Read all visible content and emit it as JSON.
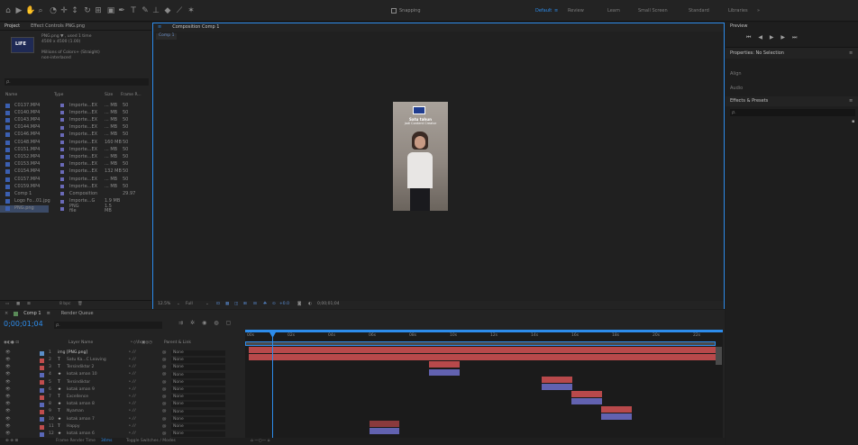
{
  "workspace": {
    "default": "Default",
    "review": "Review",
    "learn": "Learn",
    "small_screen": "Small Screen",
    "standard": "Standard",
    "libraries": "Libraries"
  },
  "toolbar": {
    "snapping": "Snapping"
  },
  "project": {
    "tab_project": "Project",
    "tab_effect_controls": "Effect Controls PNG.png",
    "preview_name": "PNG.png ▼ , used 1 time",
    "preview_size": "4500 x 4500 (1.00)",
    "preview_color": "Millions of Colors+ (Straight)",
    "preview_interlace": "non-interlaced",
    "thumb_text": "LIFE",
    "search_placeholder": "ρ.",
    "col_name": "Name",
    "col_type": "Type",
    "col_size": "Size",
    "col_frame": "Frame R...",
    "files": [
      {
        "name": "C0137.MP4",
        "type": "Importe...EX",
        "size": "... MB",
        "fr": "50"
      },
      {
        "name": "C0140.MP4",
        "type": "Importe...EX",
        "size": "... MB",
        "fr": "50"
      },
      {
        "name": "C0143.MP4",
        "type": "Importe...EX",
        "size": "... MB",
        "fr": "50"
      },
      {
        "name": "C0144.MP4",
        "type": "Importe...EX",
        "size": "... MB",
        "fr": "50"
      },
      {
        "name": "C0146.MP4",
        "type": "Importe...EX",
        "size": "... MB",
        "fr": "50"
      },
      {
        "name": "C0148.MP4",
        "type": "Importe...EX",
        "size": "160 MB",
        "fr": "50"
      },
      {
        "name": "C0151.MP4",
        "type": "Importe...EX",
        "size": "... MB",
        "fr": "50"
      },
      {
        "name": "C0152.MP4",
        "type": "Importe...EX",
        "size": "... MB",
        "fr": "50"
      },
      {
        "name": "C0153.MP4",
        "type": "Importe...EX",
        "size": "... MB",
        "fr": "50"
      },
      {
        "name": "C0154.MP4",
        "type": "Importe...EX",
        "size": "132 MB",
        "fr": "50"
      },
      {
        "name": "C0157.MP4",
        "type": "Importe...EX",
        "size": "... MB",
        "fr": "50"
      },
      {
        "name": "C0159.MP4",
        "type": "Importe...EX",
        "size": "... MB",
        "fr": "50"
      },
      {
        "name": "Comp 1",
        "type": "Composition",
        "size": "",
        "fr": "29.97"
      },
      {
        "name": "Logo Fo...01.jpg",
        "type": "Importe...G",
        "size": "1.9 MB",
        "fr": ""
      },
      {
        "name": "PNG.png",
        "type": "PNG file",
        "size": "1.5 MB",
        "fr": ""
      }
    ],
    "bpc": "8 bpc"
  },
  "composition": {
    "tab": "Composition Comp 1",
    "comp_tab": "Comp 1",
    "zoom": "12.5%",
    "resolution": "Full",
    "exposure": "+0.0",
    "timecode": "0;00;01;04",
    "overlay_title": "Satu tahun",
    "overlay_line2": "jadi Content Creator"
  },
  "right": {
    "preview": "Preview",
    "properties": "Properties: No Selection",
    "align": "Align",
    "audio": "Audio",
    "effects": "Effects & Presets",
    "search": "ρ."
  },
  "timeline": {
    "tab_comp": "Comp 1",
    "tab_render": "Render Queue",
    "timecode": "0;00;01;04",
    "search": "ρ.",
    "col_layer_name": "Layer Name",
    "col_parent": "Parent & Link",
    "ruler": [
      "00s",
      "02s",
      "04s",
      "06s",
      "08s",
      "10s",
      "12s",
      "14s",
      "16s",
      "18s",
      "20s",
      "22s"
    ],
    "footer_render": "Frame Render Time",
    "footer_render_val": "34ms",
    "footer_toggle": "Toggle Switches / Modes",
    "layers": [
      {
        "num": "1",
        "kind": "img",
        "name": "[PNG.png]",
        "parent": "None"
      },
      {
        "num": "2",
        "kind": "T",
        "name": "Satu Ka...C Leaving",
        "parent": "None"
      },
      {
        "num": "3",
        "kind": "T",
        "name": "Tersindiktor 2",
        "parent": "None"
      },
      {
        "num": "4",
        "kind": "★",
        "name": "kotak aman 10",
        "parent": "None"
      },
      {
        "num": "5",
        "kind": "T",
        "name": "Tersindiktor",
        "parent": "None"
      },
      {
        "num": "6",
        "kind": "★",
        "name": "kotak aman 9",
        "parent": "None"
      },
      {
        "num": "7",
        "kind": "T",
        "name": "Excellence",
        "parent": "None"
      },
      {
        "num": "8",
        "kind": "★",
        "name": "kotak aman 8",
        "parent": "None"
      },
      {
        "num": "9",
        "kind": "T",
        "name": "Nyaman",
        "parent": "None"
      },
      {
        "num": "10",
        "kind": "★",
        "name": "kotak aman 7",
        "parent": "None"
      },
      {
        "num": "11",
        "kind": "T",
        "name": "Happy",
        "parent": "None"
      },
      {
        "num": "12",
        "kind": "★",
        "name": "kotak aman 6",
        "parent": "None"
      }
    ]
  },
  "colors": {
    "accent": "#2d8ceb",
    "red_bar": "#b8494b",
    "purple_bar": "#6262b0",
    "dark_red_bar": "#8a3a3d"
  }
}
